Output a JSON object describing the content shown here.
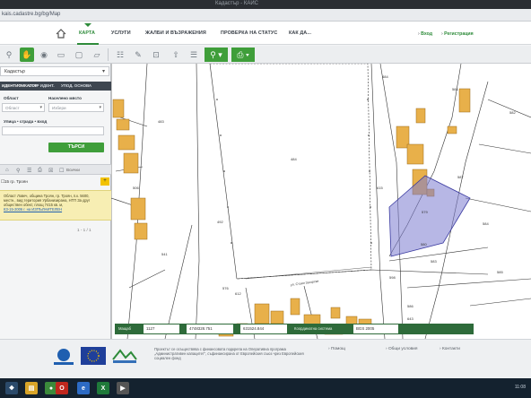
{
  "browser": {
    "title": "Кадастър - КАИС",
    "url": "kais.cadastre.bg/bg/Map"
  },
  "nav": {
    "home_label": "Начало",
    "items": [
      {
        "label": "КАРТА",
        "active": true
      },
      {
        "label": "УСЛУГИ",
        "active": false
      },
      {
        "label": "ЖАЛБИ И ВЪЗРАЖЕНИЯ",
        "active": false
      },
      {
        "label": "ПРОВЕРКА НА СТАТУС",
        "active": false
      },
      {
        "label": "КАК ДА...",
        "active": false
      }
    ],
    "login": "Вход",
    "register": "Регистрация"
  },
  "toolbar": {
    "icons": [
      "search-icon",
      "hand-icon",
      "globe-icon",
      "rectangle-select-icon",
      "info-icon",
      "polygon-select-icon",
      "table-icon",
      "ruler-icon",
      "area-measure-icon",
      "upload-icon",
      "layers-icon",
      "location-icon",
      "print-icon"
    ]
  },
  "panel": {
    "layer_select": "Кадастър",
    "tabs": [
      "ИДЕНТИФИКАТОР",
      "СТАР ИДЕНТ.",
      "УПОД. ОСНОВА"
    ],
    "field_area_label": "Област",
    "field_settlement_label": "Населено място",
    "area_value": "Област",
    "settlement_value": "Избери",
    "address_label": "Улица • сграда • вход",
    "search_button": "ТЪРСИ",
    "results_label": "Всички",
    "result_title": "15 гр. Троян",
    "result_text_1": "Област Ловеч, община Троян, гр. Троян, п.к. 5600,",
    "result_text_2": "местн., вид територия Урбанизирана, НТП За друг",
    "result_text_3": "обществен обект, площ 7415 кв. м,",
    "result_link": "КЗ-15-2006 г. на ИЗПЪЛНИТЕЛЕН",
    "pager": "1 - 1 / 1"
  },
  "map": {
    "highlight_color": "#7b7bd0",
    "parcel_labels": [
      "483",
      "484",
      "506",
      "492",
      "541",
      "484",
      "579",
      "580",
      "582",
      "583",
      "585",
      "586",
      "643",
      "615",
      "598",
      "612",
      "587",
      "584",
      "576",
      "581"
    ],
    "street_label": "ул. Стоян Загорски"
  },
  "status": {
    "scale_label": "Мащаб",
    "scale_value": "1127",
    "x_value": "4748328.751",
    "y_value": "631524.844",
    "coords_label": "Координатна система",
    "coords_value": "BGS 2005"
  },
  "footer": {
    "fund_text": "Проектът се осъществява с финансовата подкрепа на Оперативна програма „Административен капацитет“, съфинансирана от Европейския съюз чрез Европейския социален фонд",
    "links": [
      "Помощ",
      "Общи условия",
      "Контакти"
    ]
  },
  "taskbar": {
    "time": "11:08"
  }
}
